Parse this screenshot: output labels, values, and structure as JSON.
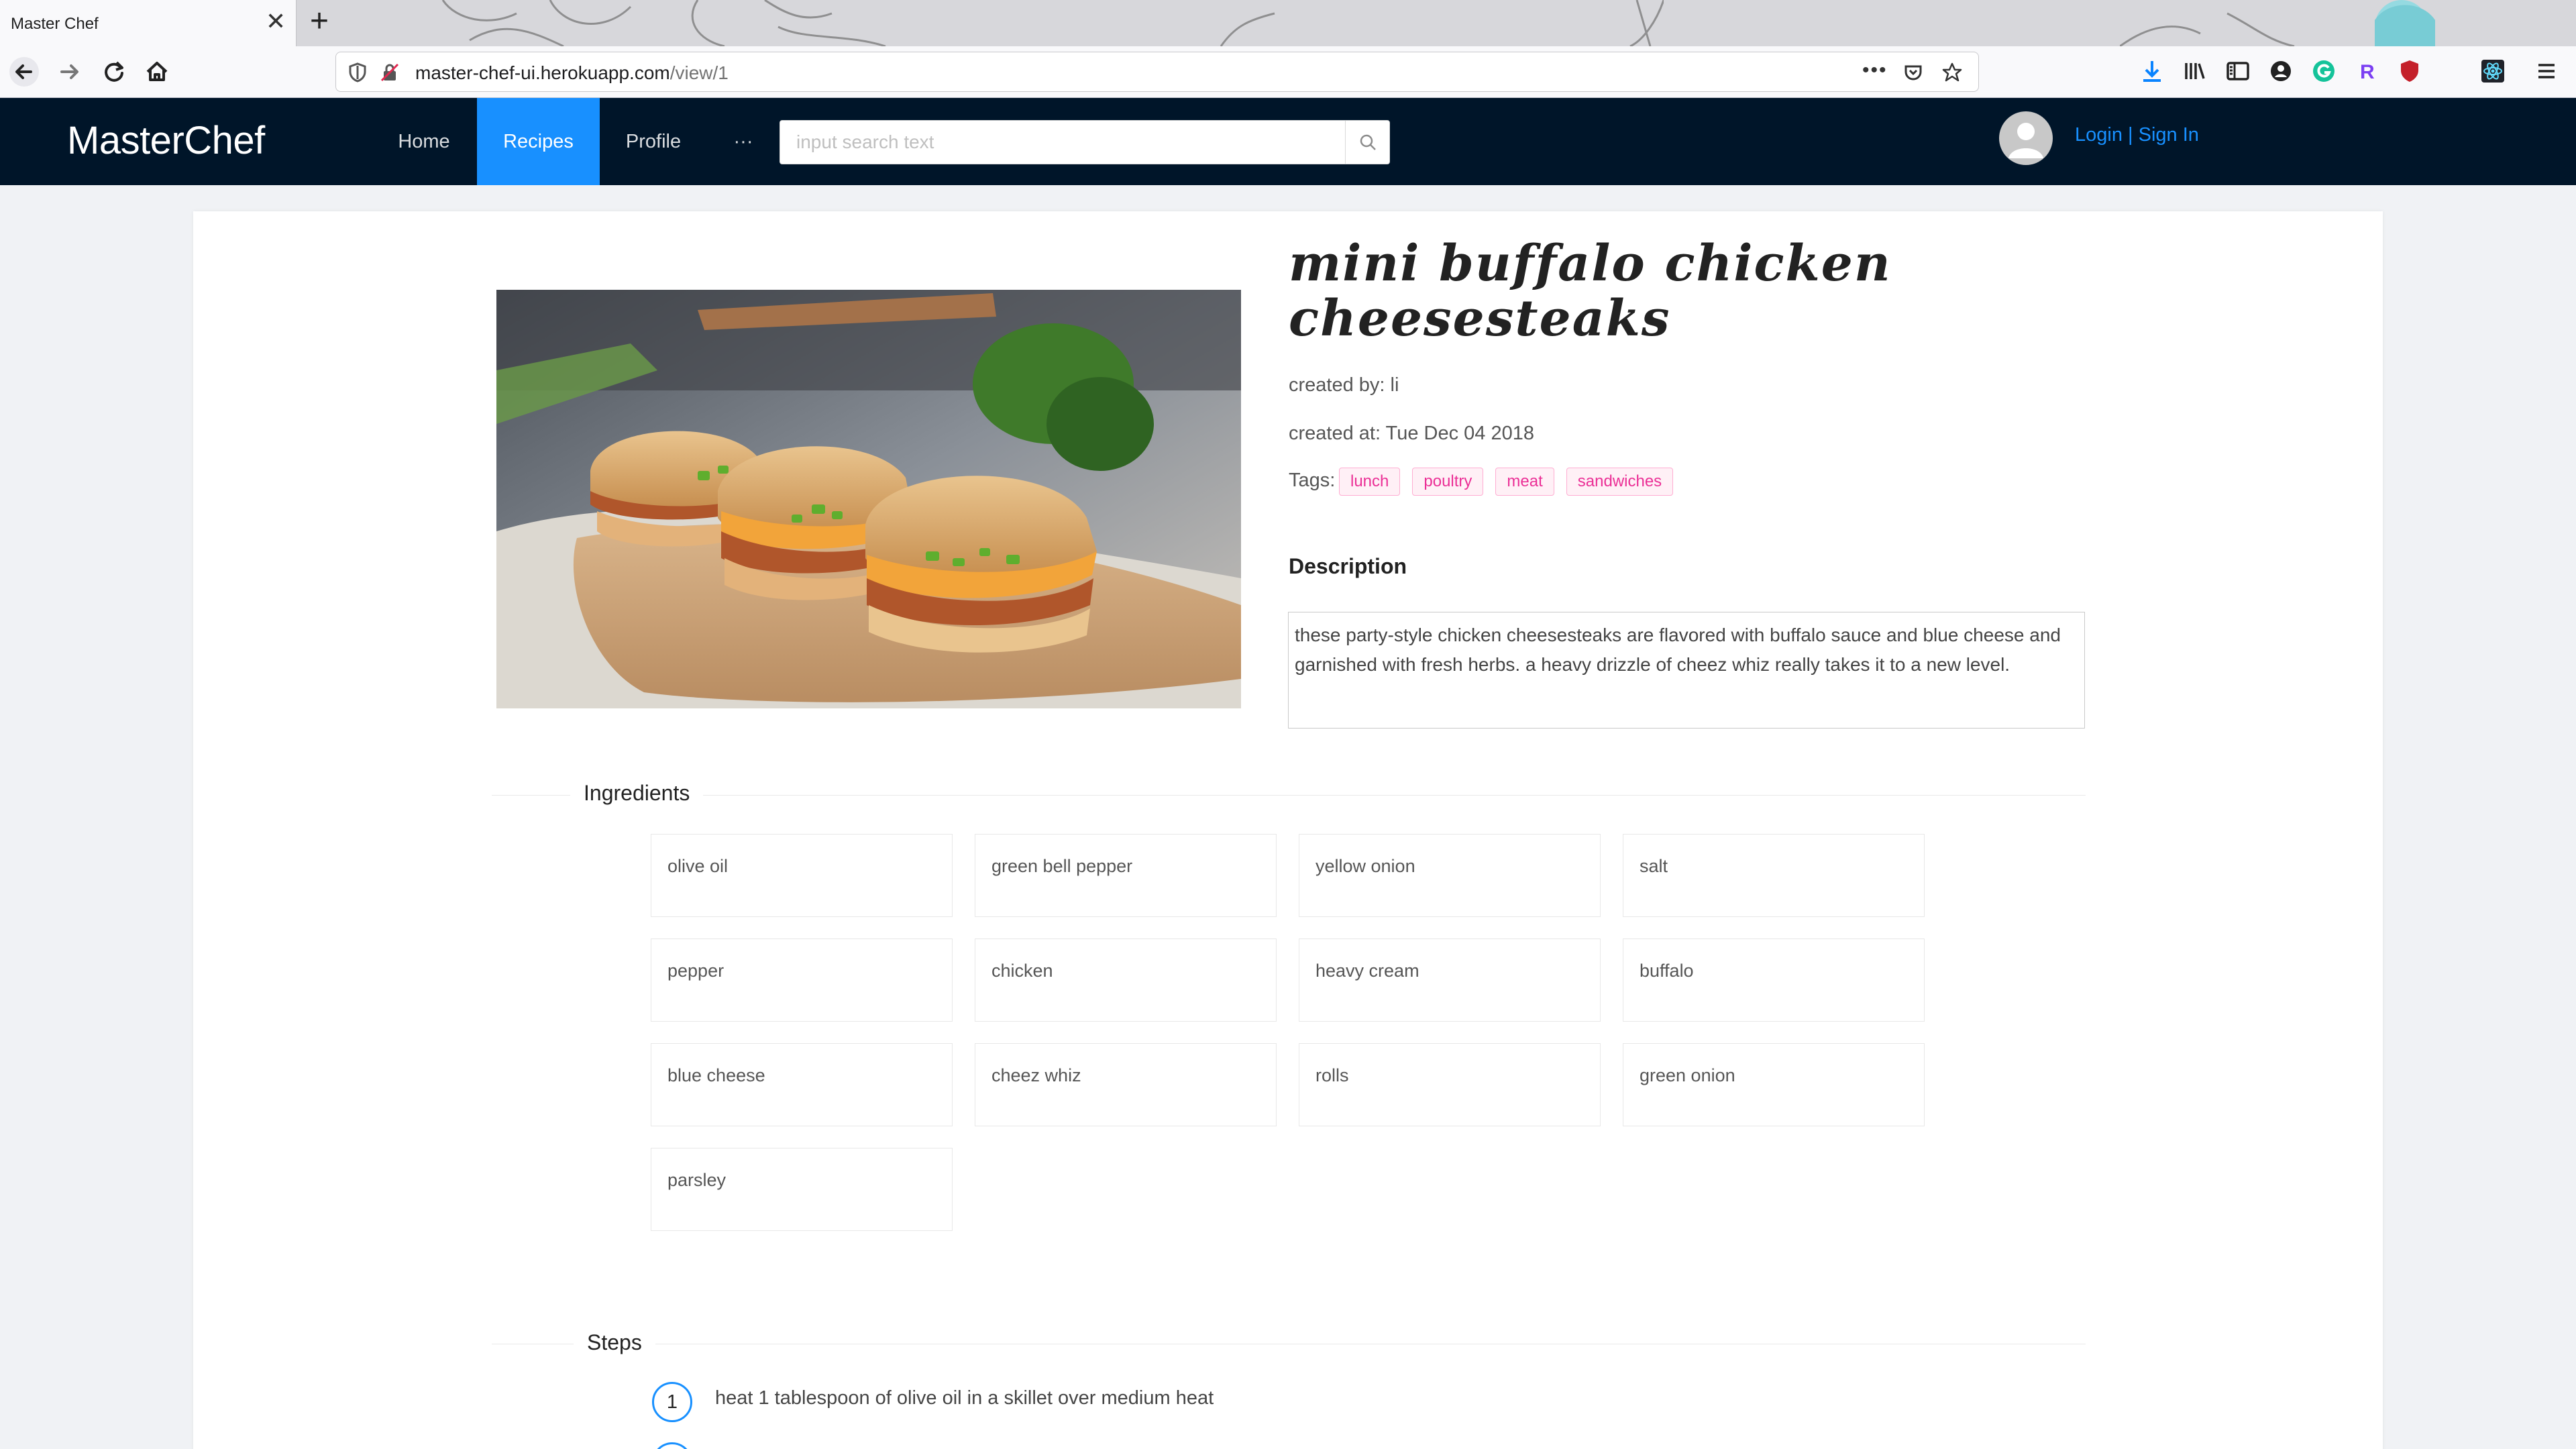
{
  "browser": {
    "tab_title": "Master Chef",
    "tab_close": "✕",
    "new_tab": "+",
    "url_host": "master-chef-ui.herokuapp.com",
    "url_path": "/view/1",
    "url_more": "•••"
  },
  "header": {
    "brand": "MasterChef",
    "menu": [
      {
        "label": "Home",
        "active": false
      },
      {
        "label": "Recipes",
        "active": true
      },
      {
        "label": "Profile",
        "active": false
      },
      {
        "label": "···",
        "active": false
      }
    ],
    "search_placeholder": "input search text",
    "login_label": "Login",
    "separator": "|",
    "signin_label": "Sign In",
    "active_color": "#1890ff",
    "bar_color": "#001529"
  },
  "recipe": {
    "title": "mini buffalo chicken cheesesteaks",
    "created_by": "created by: li",
    "created_at": "created at: Tue Dec 04 2018",
    "tags_label": "Tags:",
    "tags": [
      "lunch",
      "poultry",
      "meat",
      "sandwiches"
    ],
    "description_heading": "Description",
    "description": "these party-style chicken cheesesteaks are flavored with buffalo sauce and blue cheese and garnished with fresh herbs. a heavy drizzle of cheez whiz really takes it to a new level."
  },
  "ingredients": {
    "heading": "Ingredients",
    "items": [
      "olive oil",
      "green bell pepper",
      "yellow onion",
      "salt",
      "pepper",
      "chicken",
      "heavy cream",
      "buffalo",
      "blue cheese",
      "cheez whiz",
      "rolls",
      "green onion",
      "parsley"
    ]
  },
  "steps": {
    "heading": "Steps",
    "items": [
      {
        "number": "1",
        "text": "heat 1 tablespoon of olive oil in a skillet over medium heat"
      }
    ]
  }
}
